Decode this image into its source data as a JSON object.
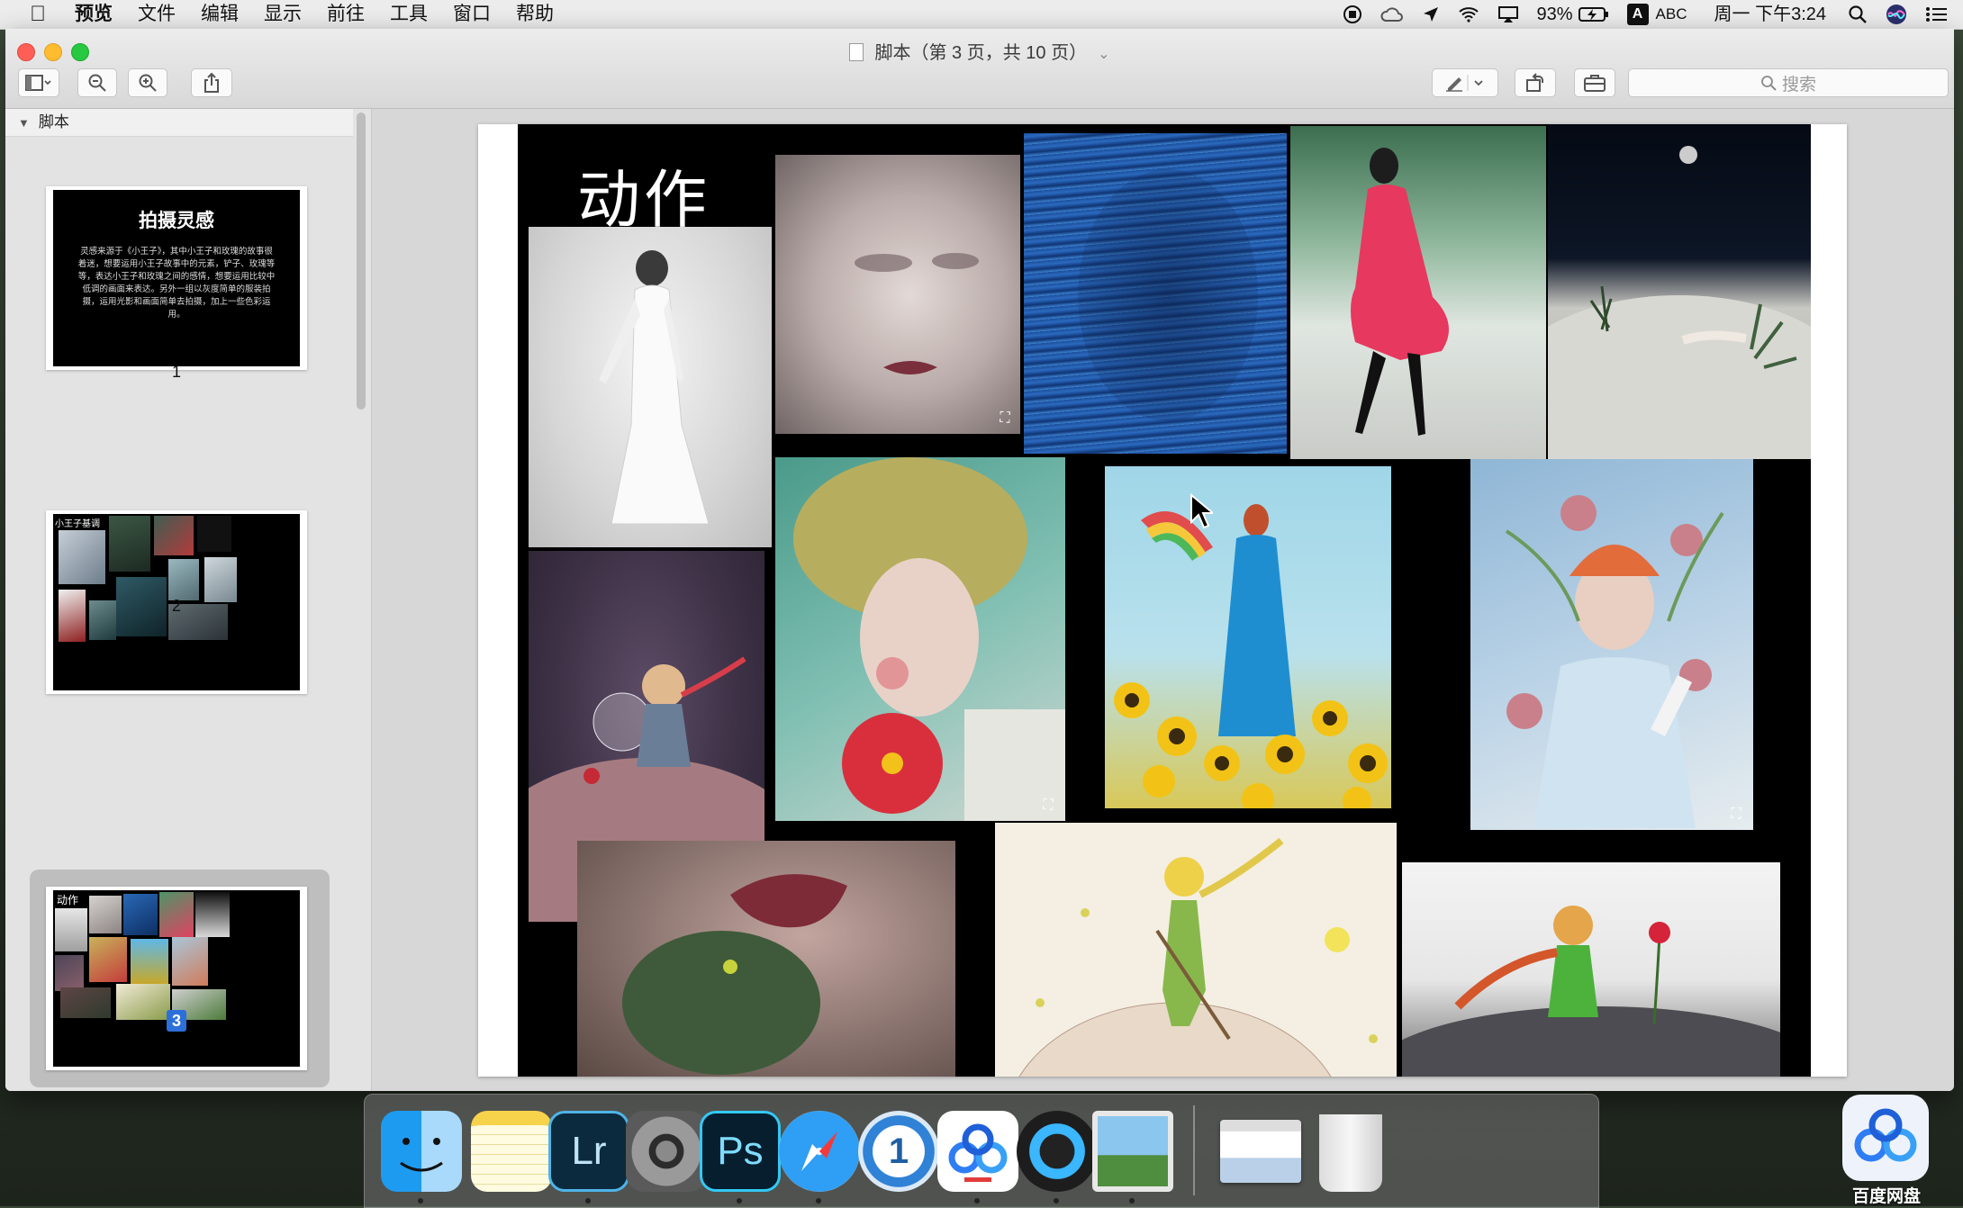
{
  "menubar": {
    "app_name": "预览",
    "items": [
      "文件",
      "编辑",
      "显示",
      "前往",
      "工具",
      "窗口",
      "帮助"
    ],
    "battery": "93%",
    "input_method": "ABC",
    "datetime": "周一 下午3:24"
  },
  "window": {
    "title": "脚本（第 3 页，共 10 页）",
    "search_placeholder": "搜索"
  },
  "sidebar": {
    "root_label": "脚本",
    "pages": [
      {
        "number": "1",
        "title": "拍摄灵感",
        "body": "灵感来源于《小王子》，其中小王子和玫瑰的故事很着迷，想要运用小王子故事中的元素，铲子、玫瑰等等，表达小王子和玫瑰之间的感情，想要运用比较中低调的画面来表达。另外一组以灰度简单的服装拍摄，运用光影和画面简单去拍摄，加上一些色彩运用。"
      },
      {
        "number": "2",
        "title": "小王子基调"
      },
      {
        "number": "3",
        "title": "动作",
        "selected": true
      }
    ]
  },
  "page": {
    "heading": "动作"
  },
  "dock": {
    "apps": [
      "finder",
      "notes",
      "lightroom",
      "system-preferences",
      "photoshop",
      "safari",
      "1password",
      "baidu-netdisk",
      "quicktime",
      "preview",
      "screenshot-safari",
      "trash"
    ],
    "lr_text": "Lr",
    "ps_text": "Ps",
    "onepass_text": "1"
  },
  "desktop": {
    "baidu_label": "百度网盘"
  }
}
